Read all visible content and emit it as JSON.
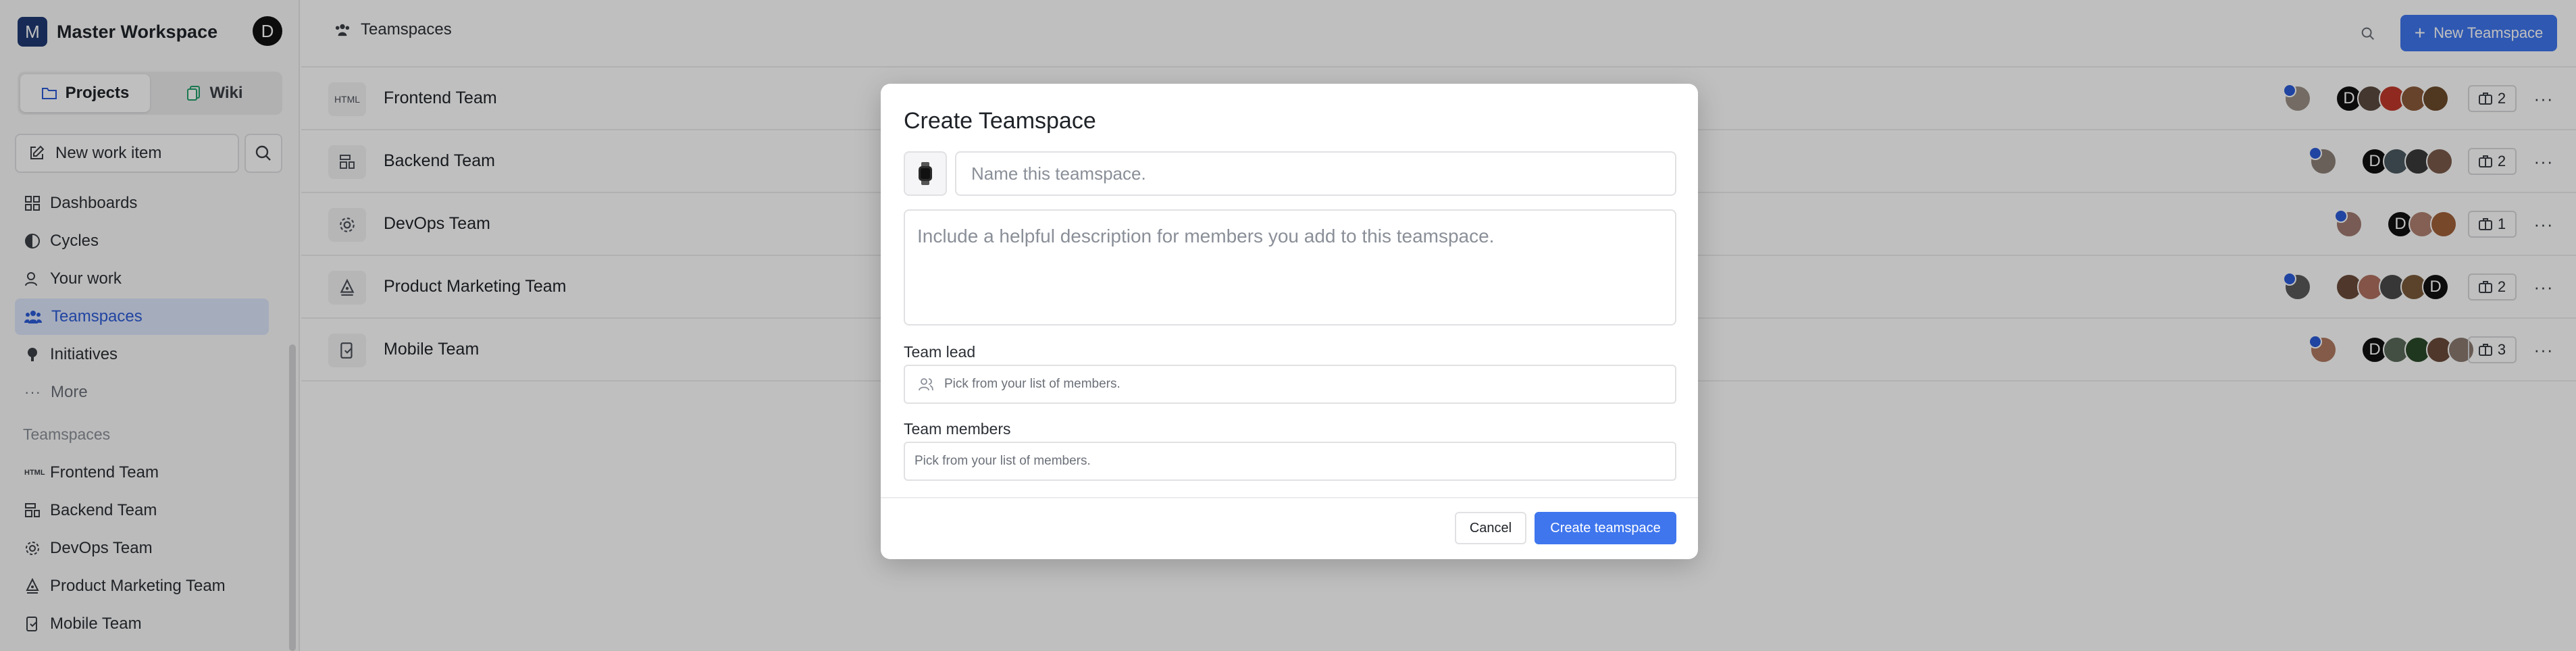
{
  "workspace": {
    "logo_letter": "M",
    "name": "Master Workspace",
    "user_initial": "D"
  },
  "switcher": {
    "projects_label": "Projects",
    "wiki_label": "Wiki"
  },
  "sidebar": {
    "new_item_label": "New work item",
    "nav": [
      {
        "label": "Dashboards",
        "icon": "dashboard-icon"
      },
      {
        "label": "Cycles",
        "icon": "cycles-icon"
      },
      {
        "label": "Your work",
        "icon": "user-icon"
      },
      {
        "label": "Teamspaces",
        "icon": "teamspaces-icon",
        "active": true
      },
      {
        "label": "Initiatives",
        "icon": "initiative-icon"
      },
      {
        "label": "More",
        "icon": "more-icon"
      }
    ],
    "teamspaces_title": "Teamspaces",
    "teams": [
      {
        "label": "Frontend Team",
        "icon": "html-icon"
      },
      {
        "label": "Backend Team",
        "icon": "server-icon"
      },
      {
        "label": "DevOps Team",
        "icon": "gear-icon"
      },
      {
        "label": "Product Marketing Team",
        "icon": "pen-tool-icon"
      },
      {
        "label": "Mobile Team",
        "icon": "mobile-icon"
      }
    ]
  },
  "header": {
    "breadcrumb": "Teamspaces",
    "new_button_label": "New Teamspace"
  },
  "html_icon_text": "HTML",
  "teams": [
    {
      "name": "Frontend Team",
      "project_count": "2",
      "lead_initial": "",
      "member_initials": [
        "D",
        "",
        "",
        "",
        ""
      ]
    },
    {
      "name": "Backend Team",
      "project_count": "2",
      "member_initials": [
        "D",
        "",
        "",
        ""
      ]
    },
    {
      "name": "DevOps Team",
      "project_count": "1",
      "member_initials": [
        "D",
        "",
        ""
      ]
    },
    {
      "name": "Product Marketing Team",
      "project_count": "2",
      "member_initials": [
        "",
        "",
        "",
        "",
        "D"
      ]
    },
    {
      "name": "Mobile Team",
      "project_count": "3",
      "member_initials": [
        "D",
        "",
        "",
        "",
        ""
      ]
    }
  ],
  "modal": {
    "title": "Create Teamspace",
    "name_placeholder": "Name this teamspace.",
    "description_placeholder": "Include a helpful description for members you add to this teamspace.",
    "team_lead_label": "Team lead",
    "team_lead_placeholder": "Pick from your list of members.",
    "team_members_label": "Team members",
    "team_members_placeholder": "Pick from your list of members.",
    "cancel_label": "Cancel",
    "create_label": "Create teamspace"
  },
  "colors": {
    "accent": "#3f76ee",
    "active_nav_bg": "#dde6fb",
    "active_nav_text": "#2b5bd7",
    "logo_bg": "#1f3a73"
  }
}
